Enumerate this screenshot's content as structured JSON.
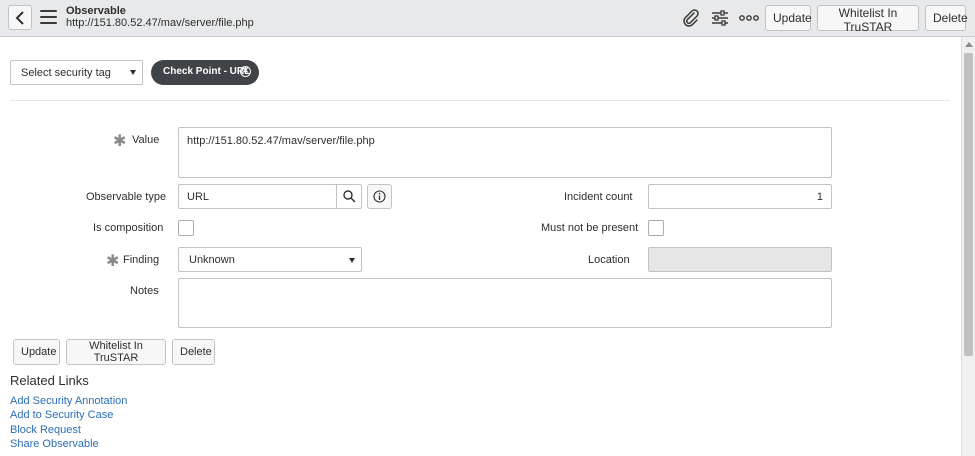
{
  "header": {
    "title": "Observable",
    "subtitle": "http://151.80.52.47/mav/server/file.php",
    "buttons": {
      "update": "Update",
      "whitelist": "Whitelist In TruSTAR",
      "delete": "Delete"
    },
    "icons": [
      "back-icon",
      "menu-icon",
      "paperclip-icon",
      "sliders-icon",
      "more-icon"
    ]
  },
  "tags": {
    "select_placeholder": "Select security tag",
    "applied": "Check Point - URL"
  },
  "form": {
    "value_label": "Value",
    "value": "http://151.80.52.47/mav/server/file.php",
    "observable_type_label": "Observable type",
    "observable_type": "URL",
    "incident_count_label": "Incident count",
    "incident_count": "1",
    "is_composition_label": "Is composition",
    "must_not_be_present_label": "Must not be present",
    "finding_label": "Finding",
    "finding": "Unknown",
    "location_label": "Location",
    "location": "",
    "notes_label": "Notes",
    "notes": ""
  },
  "actions": {
    "update": "Update",
    "whitelist": "Whitelist In TruSTAR",
    "delete": "Delete"
  },
  "related": {
    "title": "Related Links",
    "links": [
      "Add Security Annotation",
      "Add to Security Case",
      "Block Request",
      "Share Observable"
    ]
  }
}
